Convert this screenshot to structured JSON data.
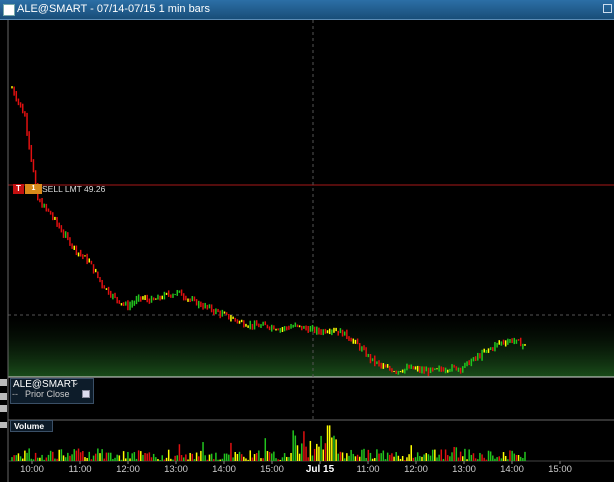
{
  "window": {
    "title": "ALE@SMART - 07/14-07/15 1 min bars"
  },
  "order": {
    "t_label": "T",
    "chip_label": "1",
    "text": "SELL LMT 49.26"
  },
  "legend": {
    "symbol": "ALE@SMART",
    "prior_close_label": "Prior Close"
  },
  "volume_panel": {
    "label": "Volume"
  },
  "colors": {
    "up": "#22c51e",
    "down": "#e01010",
    "flat": "#ffff00",
    "order_line": "#a81818",
    "grid": "#555555"
  },
  "chart_data": [
    {
      "type": "line",
      "subtype": "ohlc-bars",
      "title": "ALE@SMART - 07/14-07/15 1 min bars",
      "x_ticks": [
        "10:00",
        "11:00",
        "12:00",
        "13:00",
        "14:00",
        "15:00",
        "Jul 15",
        "11:00",
        "12:00",
        "13:00",
        "14:00",
        "15:00"
      ],
      "x_highlight": "Jul 15",
      "price_close_path": [
        [
          0,
          49.8
        ],
        [
          2,
          49.7
        ],
        [
          4,
          49.4
        ],
        [
          6,
          49.35
        ],
        [
          8,
          49.28
        ],
        [
          10,
          49.22
        ],
        [
          12,
          49.18
        ],
        [
          14,
          49.1
        ],
        [
          16,
          49.05
        ],
        [
          18,
          49.02
        ],
        [
          20,
          49.05
        ],
        [
          22,
          49.04
        ],
        [
          24,
          49.06
        ],
        [
          26,
          49.07
        ],
        [
          28,
          49.04
        ],
        [
          30,
          49.02
        ],
        [
          32,
          49.0
        ],
        [
          34,
          48.98
        ],
        [
          36,
          48.96
        ],
        [
          38,
          48.95
        ],
        [
          40,
          48.95
        ],
        [
          42,
          48.94
        ],
        [
          44,
          48.95
        ],
        [
          46,
          48.94
        ],
        [
          48,
          48.93
        ],
        [
          50,
          48.94
        ],
        [
          52,
          48.92
        ],
        [
          54,
          48.88
        ],
        [
          56,
          48.83
        ],
        [
          58,
          48.8
        ],
        [
          60,
          48.79
        ],
        [
          62,
          48.8
        ],
        [
          64,
          48.79
        ],
        [
          66,
          48.79
        ],
        [
          68,
          48.8
        ],
        [
          70,
          48.8
        ],
        [
          72,
          48.83
        ],
        [
          74,
          48.86
        ],
        [
          76,
          48.89
        ],
        [
          78,
          48.9
        ],
        [
          80,
          48.88
        ]
      ],
      "order_line_price": 49.26,
      "prior_close_price": 48.93,
      "grid": false,
      "legend_position": "bottom-left"
    },
    {
      "type": "bar",
      "title": "Volume",
      "categories": [
        "10:00",
        "11:00",
        "12:00",
        "13:00",
        "14:00",
        "15:00",
        "Jul 15",
        "11:00",
        "12:00",
        "13:00",
        "14:00"
      ],
      "values": [
        0.3,
        0.35,
        0.3,
        0.25,
        0.3,
        0.3,
        1.0,
        0.35,
        0.25,
        0.4,
        0.3
      ],
      "ylim": [
        0,
        1
      ]
    }
  ]
}
